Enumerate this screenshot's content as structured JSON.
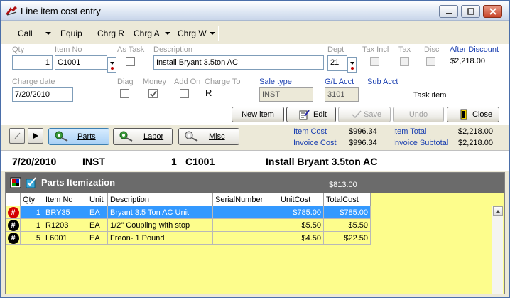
{
  "window": {
    "title": "Line item cost entry"
  },
  "toolbar": {
    "call": "Call",
    "equip": "Equip",
    "chrg_r": "Chrg R",
    "chrg_a": "Chrg A",
    "chrg_w": "Chrg W"
  },
  "form": {
    "qty_label": "Qty",
    "qty": "1",
    "item_no_label": "Item No",
    "item_no": "C1001",
    "as_task_label": "As Task",
    "description_label": "Description",
    "description": "Install Bryant 3.5ton AC",
    "dept_label": "Dept",
    "dept": "21",
    "tax_incl_label": "Tax Incl",
    "tax_label": "Tax",
    "disc_label": "Disc",
    "after_discount_label": "After Discount",
    "after_discount": "$2,218.00",
    "charge_date_label": "Charge date",
    "charge_date": "7/20/2010",
    "diag_label": "Diag",
    "money_label": "Money",
    "add_on_label": "Add On",
    "charge_to_label": "Charge To",
    "charge_to": "R",
    "sale_type_label": "Sale type",
    "sale_type": "INST",
    "gl_acct_label": "G/L Acct",
    "gl_acct": "3101",
    "sub_acct_label": "Sub Acct",
    "task_item": "Task item",
    "money_checked": true
  },
  "actions": {
    "new_item": "New item",
    "edit": "Edit",
    "save": "Save",
    "undo": "Undo",
    "close": "Close"
  },
  "tabs": {
    "parts": "Parts",
    "labor": "Labor",
    "misc": "Misc"
  },
  "costs": {
    "item_cost_label": "Item Cost",
    "item_cost": "$996.34",
    "invoice_cost_label": "Invoice Cost",
    "invoice_cost": "$996.34",
    "item_total_label": "Item Total",
    "item_total": "$2,218.00",
    "invoice_subtotal_label": "Invoice Subtotal",
    "invoice_subtotal": "$2,218.00"
  },
  "info": {
    "date": "7/20/2010",
    "type": "INST",
    "qty": "1",
    "item": "C1001",
    "desc": "Install Bryant 3.5ton AC"
  },
  "parts": {
    "title": "Parts Itemization",
    "total": "$813.00",
    "columns": [
      "Qty",
      "Item No",
      "Unit",
      "Description",
      "SerialNumber",
      "UnitCost",
      "TotalCost"
    ],
    "rows": [
      {
        "marker": "#",
        "qty": "1",
        "item_no": "BRY35",
        "unit": "EA",
        "description": "Bryant 3.5 Ton AC Unit",
        "serial": "",
        "unit_cost": "$785.00",
        "total_cost": "$785.00"
      },
      {
        "marker": "#",
        "qty": "1",
        "item_no": "R1203",
        "unit": "EA",
        "description": "1/2\" Coupling with stop",
        "serial": "",
        "unit_cost": "$5.50",
        "total_cost": "$5.50"
      },
      {
        "marker": "#",
        "qty": "5",
        "item_no": "L6001",
        "unit": "EA",
        "description": "Freon- 1 Pound",
        "serial": "",
        "unit_cost": "$4.50",
        "total_cost": "$22.50"
      }
    ]
  },
  "colors": {
    "selected_row": "#3399ff",
    "panel_bg": "#fdfd8c",
    "label_blue": "#1a3fb0",
    "header_bg": "#6b6b6b"
  }
}
